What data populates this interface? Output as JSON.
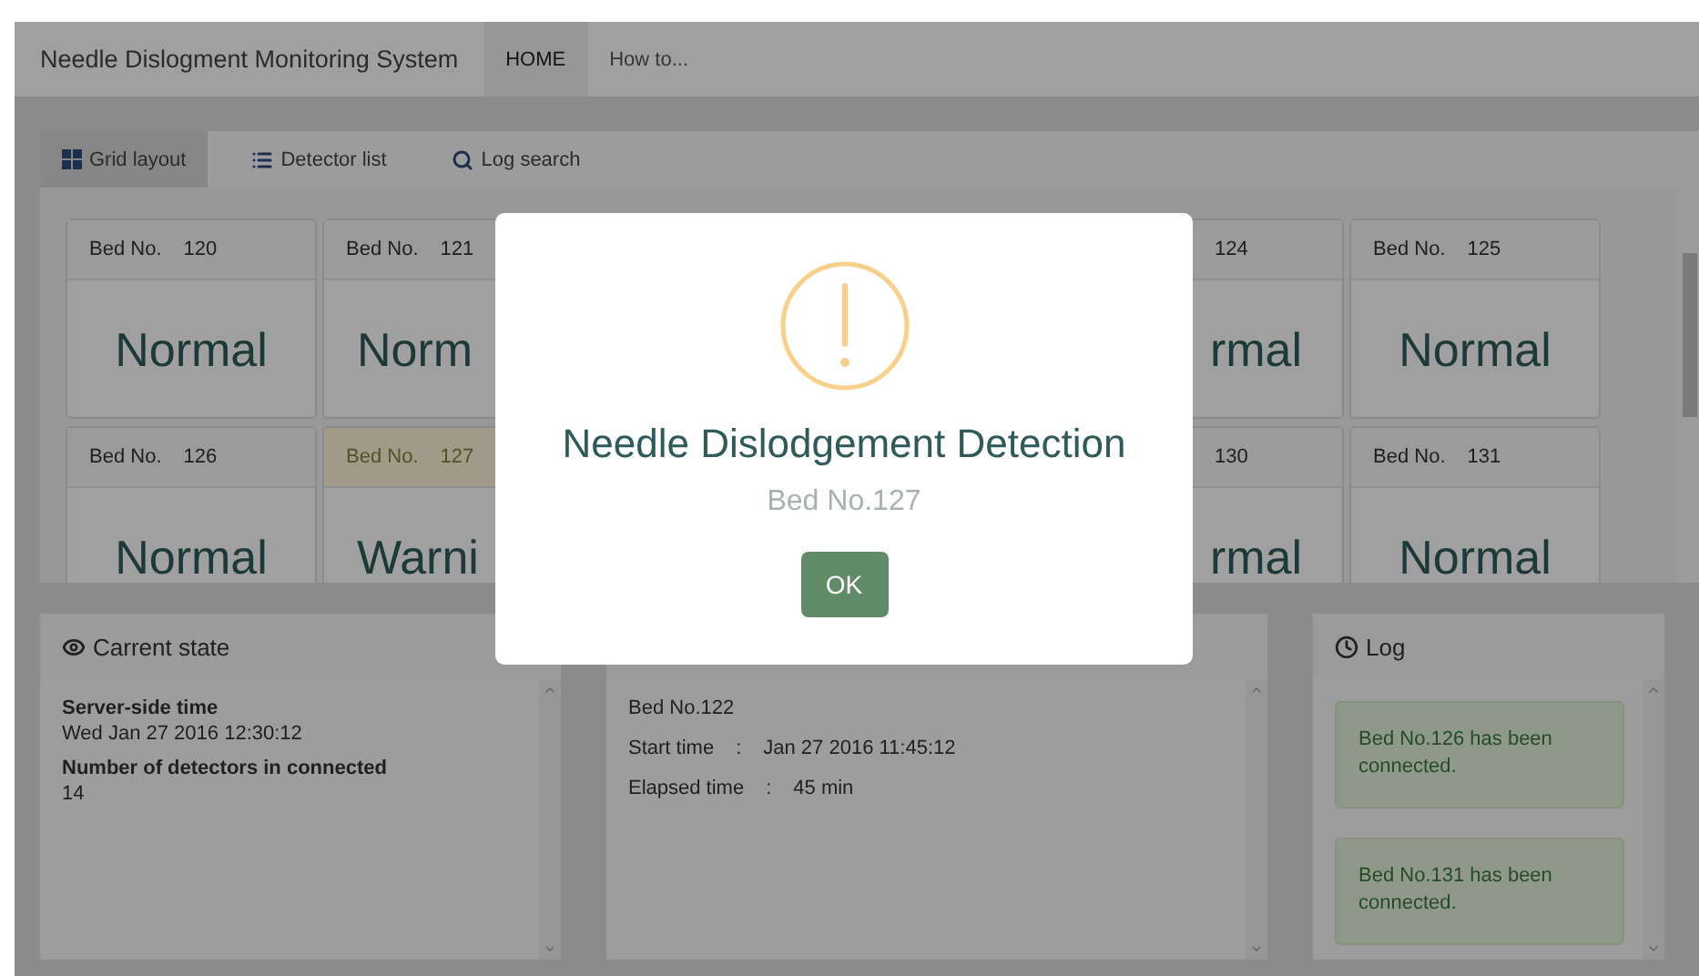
{
  "app_title": "Needle Dislogment Monitoring System",
  "nav": [
    {
      "label": "HOME",
      "selected": true
    },
    {
      "label": "How to...",
      "selected": false
    }
  ],
  "tabs": [
    {
      "label": "Grid layout",
      "selected": true
    },
    {
      "label": "Detector list",
      "selected": false
    },
    {
      "label": "Log search",
      "selected": false
    }
  ],
  "grid": {
    "rows": [
      {
        "left": [
          {
            "kind": "whole",
            "label": "Bed No.",
            "number": "120",
            "status": "Normal",
            "warning": false
          },
          {
            "kind": "head",
            "label": "Bed No.",
            "number": "121",
            "status": "Norm",
            "warning": false
          }
        ],
        "right": [
          {
            "kind": "tail",
            "number": "124",
            "status": "rmal",
            "warning": false
          },
          {
            "kind": "whole",
            "label": "Bed No.",
            "number": "125",
            "status": "Normal",
            "warning": false
          }
        ]
      },
      {
        "left": [
          {
            "kind": "whole",
            "label": "Bed No.",
            "number": "126",
            "status": "Normal",
            "warning": false
          },
          {
            "kind": "head",
            "label": "Bed No.",
            "number": "127",
            "status": "Warni",
            "warning": true
          }
        ],
        "right": [
          {
            "kind": "tail",
            "number": "130",
            "status": "rmal",
            "warning": false
          },
          {
            "kind": "whole",
            "label": "Bed No.",
            "number": "131",
            "status": "Normal",
            "warning": false
          }
        ]
      }
    ]
  },
  "current_state": {
    "title": "Carrent state",
    "fields": [
      {
        "label": "Server-side time",
        "value": "Wed Jan 27 2016 12:30:12"
      },
      {
        "label": "Number of detectors in connected",
        "value": "14"
      }
    ]
  },
  "detail": {
    "bed": "Bed No.122",
    "rows": [
      {
        "label": "Start time",
        "sep": ":",
        "value": "Jan 27 2016 11:45:12"
      },
      {
        "label": "Elapsed time",
        "sep": ":",
        "value": "45 min"
      }
    ]
  },
  "log": {
    "title": "Log",
    "entries": [
      "Bed No.126 has been connected.",
      "Bed No.131 has been connected."
    ]
  },
  "dialog": {
    "title": "Needle Dislodgement Detection",
    "subtitle": "Bed No.127",
    "button": "OK"
  }
}
